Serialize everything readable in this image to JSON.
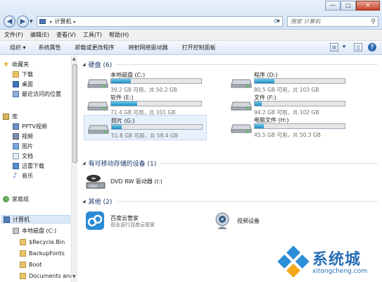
{
  "window": {
    "min_glyph": "—",
    "max_glyph": "□",
    "close_glyph": "✕"
  },
  "address_bar": {
    "crumb": "计算机",
    "separator": "▸"
  },
  "search": {
    "placeholder": "搜索 计算机"
  },
  "menu": [
    "文件(F)",
    "编辑(E)",
    "查看(V)",
    "工具(T)",
    "帮助(H)"
  ],
  "toolbar": {
    "organize": "组织 ▾",
    "system_properties": "系统属性",
    "uninstall": "卸载或更改程序",
    "map_drive": "映射网络驱动器",
    "control_panel": "打开控制面板"
  },
  "nav": {
    "favorites": "收藏夹",
    "downloads": "下载",
    "desktop": "桌面",
    "recent": "最近访问的位置",
    "libraries": "库",
    "pptv": "PPTV视频",
    "videos": "视频",
    "pictures": "图片",
    "documents": "文档",
    "thunder": "迅雷下载",
    "music": "音乐",
    "homegroup": "家庭组",
    "computer": "计算机",
    "local_c": "本地磁盘 (C:)",
    "recycle": "$Recycle.Bin",
    "backup_fonts": "BackupFonts",
    "boot": "Boot",
    "documents_and": "Documents and"
  },
  "groups": {
    "hard_disks": "硬盘 (6)",
    "removable": "有可移动存储的设备 (1)",
    "other": "其他 (2)"
  },
  "drives": [
    {
      "name": "本地磁盘 (C:)",
      "free": "39.2 GB 可用，共 50.2 GB",
      "used_fraction": 0.22
    },
    {
      "name": "程序 (D:)",
      "free": "80.5 GB 可用，共 103 GB",
      "used_fraction": 0.22
    },
    {
      "name": "软件 (E:)",
      "free": "71.4 GB 可用，共 101 GB",
      "used_fraction": 0.29
    },
    {
      "name": "文件 (F:)",
      "free": "94.2 GB 可用，共 102 GB",
      "used_fraction": 0.08
    },
    {
      "name": "照片 (G:)",
      "free": "51.8 GB 可用，共 58.4 GB",
      "used_fraction": 0.11
    },
    {
      "name": "电脑文件 (H:)",
      "free": "45.5 GB 可用，共 50.3 GB",
      "used_fraction": 0.1
    }
  ],
  "removable": {
    "name": "DVD RW 驱动器 (I:)"
  },
  "other_items": [
    {
      "name": "百度云管家",
      "sub": "双击运行百度云管家"
    },
    {
      "name": "视频设备",
      "sub": ""
    }
  ],
  "watermark": {
    "text": "系统城",
    "url": "xitongcheng.com"
  },
  "colors": {
    "bar_fill": "#1d8fc3",
    "accent": "#2a6fb7"
  }
}
